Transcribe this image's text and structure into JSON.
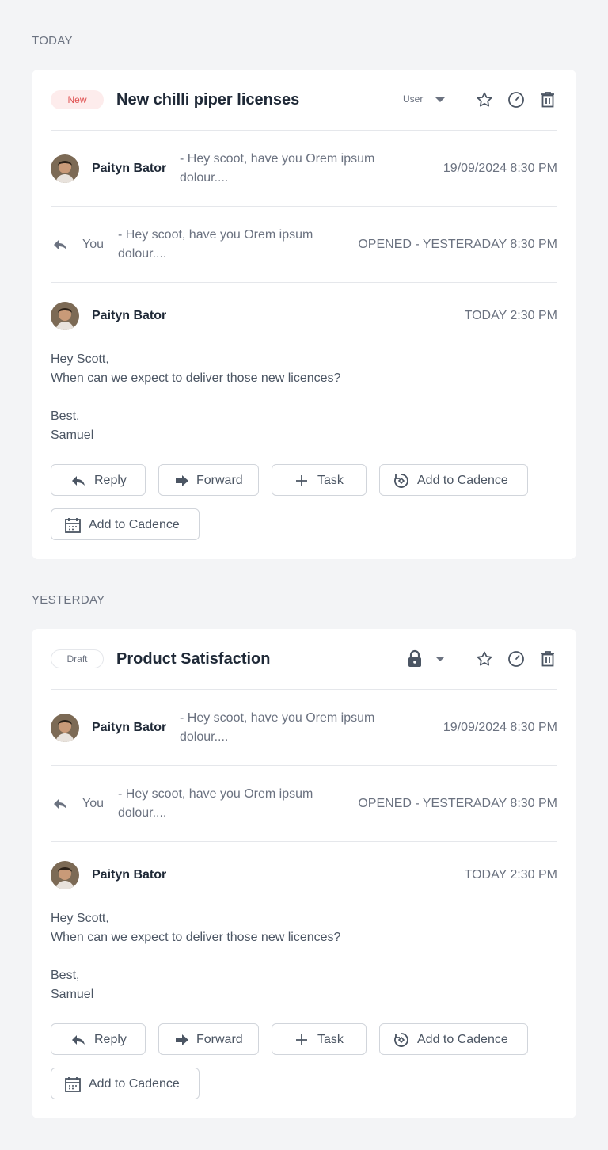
{
  "sections": [
    {
      "label": "TODAY",
      "thread": {
        "badge": "New",
        "badge_type": "new",
        "subject": "New chilli piper licenses",
        "owner": "User",
        "rows": [
          {
            "sender": "Paityn Bator",
            "preview_line1": "- Hey scoot, have you Orem ipsum",
            "preview_line2": "dolour....",
            "time": "19/09/2024 8:30 PM"
          },
          {
            "sender": "You",
            "preview_line1": "- Hey scoot, have you Orem ipsum",
            "preview_line2": "dolour....",
            "time": "OPENED - YESTERADAY 8:30 PM"
          }
        ],
        "open_message": {
          "sender": "Paityn Bator",
          "time": "TODAY 2:30 PM",
          "lines": [
            "Hey Scott,",
            "When can we expect to deliver those new licences?",
            "",
            "Best,",
            "Samuel"
          ]
        },
        "actions": [
          "Reply",
          "Forward",
          "Task",
          "Add to Cadence",
          "Add to Cadence"
        ]
      }
    },
    {
      "label": "YESTERDAY",
      "thread": {
        "badge": "Draft",
        "badge_type": "draft",
        "subject": "Product Satisfaction",
        "owner": "",
        "rows": [
          {
            "sender": "Paityn Bator",
            "preview_line1": "- Hey scoot, have you Orem ipsum",
            "preview_line2": "dolour....",
            "time": "19/09/2024 8:30 PM"
          },
          {
            "sender": "You",
            "preview_line1": "- Hey scoot, have you Orem ipsum",
            "preview_line2": "dolour....",
            "time": "OPENED - YESTERADAY 8:30 PM"
          }
        ],
        "open_message": {
          "sender": "Paityn Bator",
          "time": "TODAY 2:30 PM",
          "lines": [
            "Hey Scott,",
            "When can we expect to deliver those new licences?",
            "",
            "Best,",
            "Samuel"
          ]
        },
        "actions": [
          "Reply",
          "Forward",
          "Task",
          "Add to Cadence",
          "Add to Cadence"
        ]
      }
    }
  ],
  "icons": {
    "reply": "reply-icon",
    "forward": "forward-icon",
    "task": "plus-icon",
    "cadence": "cadence-icon",
    "calendar": "calendar-icon",
    "star": "star-icon",
    "clock": "clock-icon",
    "trash": "trash-icon",
    "lock": "lock-icon",
    "caret": "chevron-down-icon"
  },
  "colors": {
    "background": "#f3f4f6",
    "card": "#ffffff",
    "new_badge_bg": "#fdecec",
    "new_badge_text": "#e05252",
    "border": "#e5e7eb",
    "muted_text": "#6b7280"
  }
}
